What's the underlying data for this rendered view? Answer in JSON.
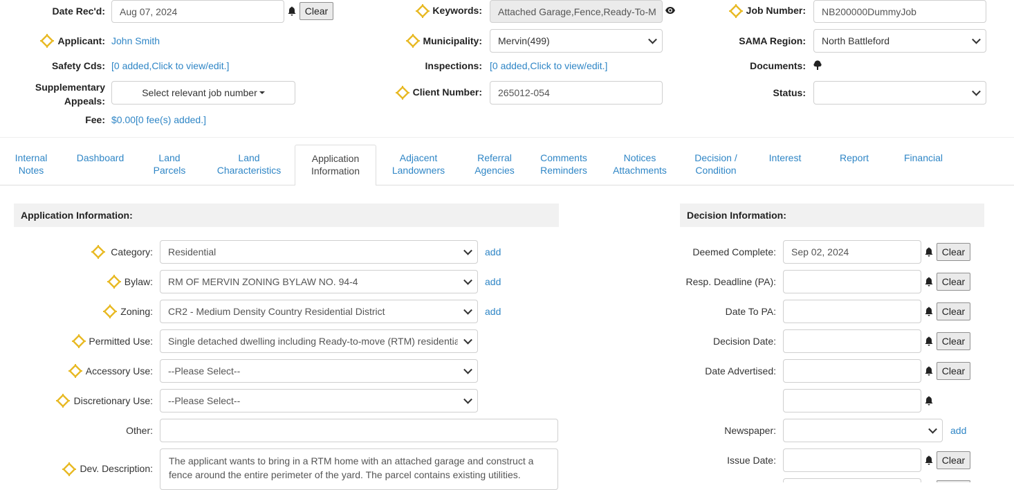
{
  "header": {
    "date_received": {
      "label": "Date Rec'd:",
      "value": "Aug 07, 2024",
      "clear": "Clear"
    },
    "applicant": {
      "label": "Applicant:",
      "value": "John Smith"
    },
    "safety_cds": {
      "label": "Safety Cds:",
      "value": "[0 added,Click to view/edit.]"
    },
    "supplementary_appeals": {
      "label_line1": "Supplementary",
      "label_line2": "Appeals:",
      "button": "Select relevant job number"
    },
    "fee": {
      "label": "Fee:",
      "value": "$0.00[0 fee(s) added.]"
    },
    "keywords": {
      "label": "Keywords:",
      "value": "Attached Garage,Fence,Ready-To-M"
    },
    "municipality": {
      "label": "Municipality:",
      "value": "Mervin(499)"
    },
    "inspections": {
      "label": "Inspections:",
      "value": "[0 added,Click to view/edit.]"
    },
    "client_number": {
      "label": "Client Number:",
      "value": "265012-054"
    },
    "job_number": {
      "label": "Job Number:",
      "value": "NB200000DummyJob"
    },
    "sama_region": {
      "label": "SAMA Region:",
      "value": "North Battleford"
    },
    "documents": {
      "label": "Documents:"
    },
    "status": {
      "label": "Status:",
      "value": ""
    }
  },
  "tabs": [
    {
      "line1": "Internal",
      "line2": "Notes"
    },
    {
      "line1": "Dashboard",
      "line2": ""
    },
    {
      "line1": "Land",
      "line2": "Parcels"
    },
    {
      "line1": "Land",
      "line2": "Characteristics"
    },
    {
      "line1": "Application",
      "line2": "Information",
      "active": true
    },
    {
      "line1": "Adjacent",
      "line2": "Landowners"
    },
    {
      "line1": "Referral",
      "line2": "Agencies"
    },
    {
      "line1": "Comments",
      "line2": "Reminders"
    },
    {
      "line1": "Notices",
      "line2": "Attachments"
    },
    {
      "line1": "Decision /",
      "line2": "Condition"
    },
    {
      "line1": "Interest",
      "line2": ""
    },
    {
      "line1": "Report",
      "line2": ""
    },
    {
      "line1": "Financial",
      "line2": ""
    }
  ],
  "application": {
    "heading": "Application Information:",
    "add_label": "add",
    "category": {
      "label": "Category:",
      "value": "Residential"
    },
    "bylaw": {
      "label": "Bylaw:",
      "value": "RM OF MERVIN ZONING BYLAW NO. 94-4"
    },
    "zoning": {
      "label": "Zoning:",
      "value": "CR2 - Medium Density Country Residential District"
    },
    "permitted_use": {
      "label": "Permitted Use:",
      "value": "Single detached dwelling including Ready-to-move (RTM) residential"
    },
    "accessory_use": {
      "label": "Accessory Use:",
      "value": "--Please Select--"
    },
    "discretionary_use": {
      "label": "Discretionary Use:",
      "value": "--Please Select--"
    },
    "other": {
      "label": "Other:",
      "value": ""
    },
    "dev_description": {
      "label": "Dev. Description:",
      "value": "The applicant wants to bring in a RTM home with an attached garage and construct a fence around the entire perimeter of the yard. The parcel contains existing utilities."
    }
  },
  "decision": {
    "heading": "Decision Information:",
    "clear": "Clear",
    "add_label": "add",
    "deemed_complete": {
      "label": "Deemed Complete:",
      "value": "Sep 02, 2024"
    },
    "resp_deadline": {
      "label": "Resp. Deadline (PA):",
      "value": ""
    },
    "date_to_pa": {
      "label": "Date To PA:",
      "value": ""
    },
    "decision_date": {
      "label": "Decision Date:",
      "value": ""
    },
    "date_advertised": {
      "label": "Date Advertised:",
      "value": ""
    },
    "extra_date": {
      "value": ""
    },
    "newspaper": {
      "label": "Newspaper:",
      "value": ""
    },
    "issue_date": {
      "label": "Issue Date:",
      "value": ""
    }
  },
  "colors": {
    "accent_link": "#2f86c6",
    "required_marker": "#e8b923",
    "panel_heading_bg": "#f1f1f1"
  },
  "icons": [
    "required-diamond-icon",
    "bell-icon",
    "eye-icon",
    "tree-icon",
    "caret-down-icon",
    "chevron-down-icon"
  ]
}
